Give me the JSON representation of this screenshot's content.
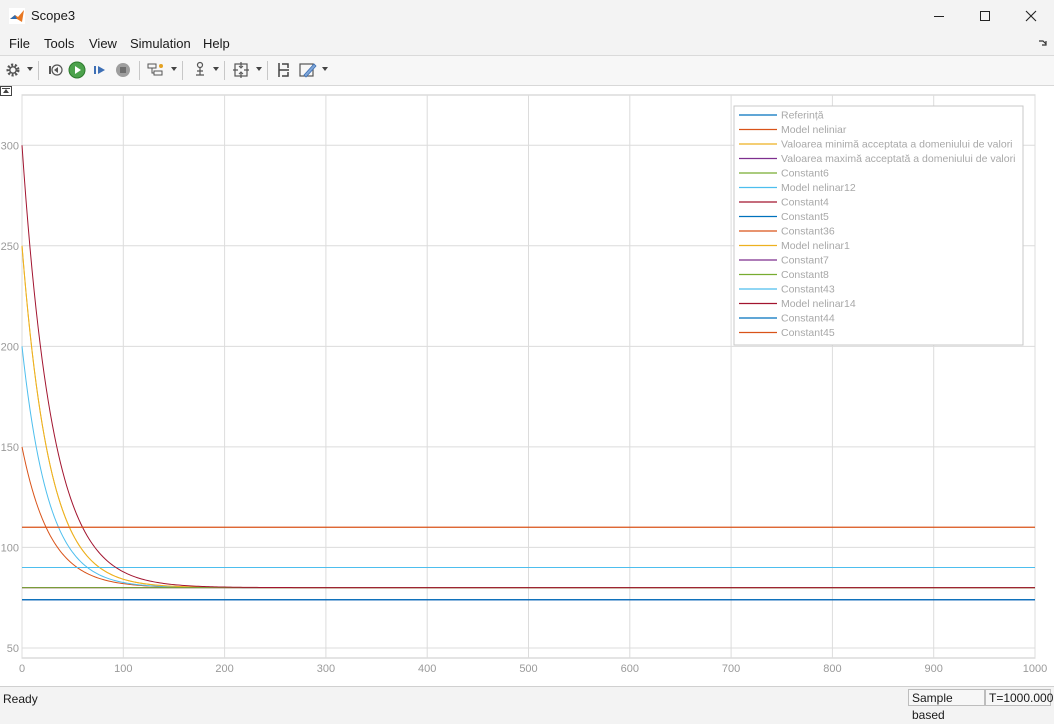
{
  "window": {
    "title": "Scope3",
    "controls": [
      "minimize-icon",
      "maximize-icon",
      "close-icon"
    ]
  },
  "menu": {
    "items": [
      "File",
      "Tools",
      "View",
      "Simulation",
      "Help"
    ]
  },
  "toolbar": {
    "buttons": [
      "settings-icon",
      "step-back-icon",
      "run-icon",
      "step-forward-icon",
      "stop-icon",
      "signal-select-icon",
      "triggers-icon",
      "zoom-fit-icon",
      "cursor-measure-icon",
      "style-icon"
    ]
  },
  "status": {
    "ready": "Ready",
    "sample_mode": "Sample based",
    "time": "T=1000.000"
  },
  "colors": {
    "c1": "#0072bd",
    "c2": "#d95319",
    "c3": "#edb120",
    "c4": "#7e2f8e",
    "c5": "#77ac30",
    "c6": "#4dbeee",
    "c7": "#a2142f",
    "grid": "#dcdcdc",
    "axis_text": "#9a9a9a"
  },
  "chart_data": {
    "type": "line",
    "xlim": [
      0,
      1000
    ],
    "ylim": [
      45,
      325
    ],
    "x_ticks": [
      0,
      100,
      200,
      300,
      400,
      500,
      600,
      700,
      800,
      900,
      1000
    ],
    "y_ticks": [
      50,
      100,
      150,
      200,
      250,
      300
    ],
    "grid": true,
    "legend_position": "top-right",
    "series": [
      {
        "name": "Referință",
        "color": "#0072bd",
        "kind": "const",
        "value": 74
      },
      {
        "name": "Model neliniar",
        "color": "#d95319",
        "kind": "decay",
        "start": 150,
        "end": 80,
        "tau": 28
      },
      {
        "name": "Valoarea minimă acceptata a domeniului de valori",
        "color": "#edb120",
        "kind": "decay",
        "start": 250,
        "end": 80,
        "tau": 27
      },
      {
        "name": "Valoarea maximă acceptată a domeniului de valori",
        "color": "#7e2f8e",
        "kind": "const",
        "value": 74
      },
      {
        "name": "Constant6",
        "color": "#77ac30",
        "kind": "const",
        "value": 80
      },
      {
        "name": "Model nelinar12",
        "color": "#4dbeee",
        "kind": "decay",
        "start": 200,
        "end": 80,
        "tau": 26
      },
      {
        "name": "Constant4",
        "color": "#a2142f",
        "kind": "const",
        "value": 80
      },
      {
        "name": "Constant5",
        "color": "#0072bd",
        "kind": "const",
        "value": 74
      },
      {
        "name": "Constant36",
        "color": "#d95319",
        "kind": "const",
        "value": 110
      },
      {
        "name": "Model nelinar1",
        "color": "#edb120",
        "kind": "decay",
        "start": 250,
        "end": 80,
        "tau": 27
      },
      {
        "name": "Constant7",
        "color": "#7e2f8e",
        "kind": "const",
        "value": 80
      },
      {
        "name": "Constant8",
        "color": "#77ac30",
        "kind": "const",
        "value": 80
      },
      {
        "name": "Constant43",
        "color": "#4dbeee",
        "kind": "const",
        "value": 90
      },
      {
        "name": "Model nelinar14",
        "color": "#a2142f",
        "kind": "decay",
        "start": 300,
        "end": 80,
        "tau": 30
      },
      {
        "name": "Constant44",
        "color": "#0072bd",
        "kind": "const",
        "value": 74
      },
      {
        "name": "Constant45",
        "color": "#d95319",
        "kind": "const",
        "value": 110
      }
    ]
  }
}
